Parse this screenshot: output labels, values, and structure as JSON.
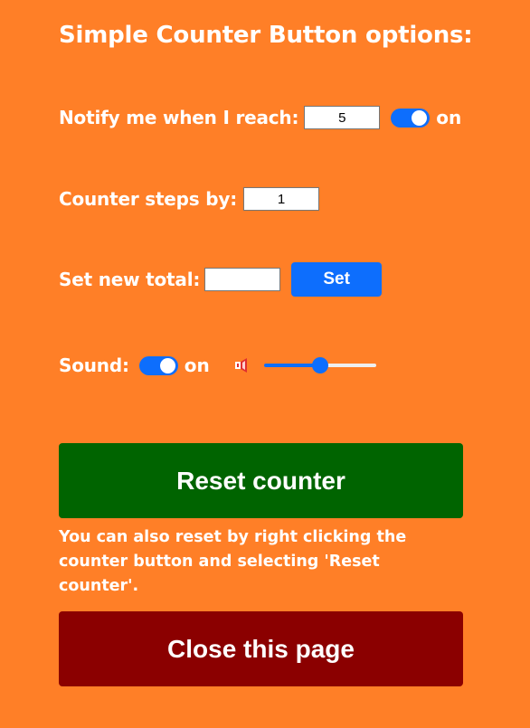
{
  "page": {
    "title": "Simple Counter Button options:"
  },
  "notify": {
    "label": "Notify me when I reach:",
    "value": "5",
    "toggle_on": true,
    "toggle_text": "on"
  },
  "steps": {
    "label": "Counter steps by:",
    "value": "1"
  },
  "total": {
    "label": "Set new total:",
    "value": "",
    "button_label": "Set"
  },
  "sound": {
    "label": "Sound:",
    "toggle_on": true,
    "toggle_text": "on",
    "speaker_icon": "speaker-icon",
    "volume_fraction": 0.5
  },
  "reset": {
    "button_label": "Reset counter",
    "help_text": "You can also reset by right clicking the counter button and selecting 'Reset counter'."
  },
  "close": {
    "button_label": "Close this page"
  },
  "colors": {
    "background": "#ff7f27",
    "accent": "#0d6efd",
    "reset_button": "#006400",
    "close_button": "#8b0000"
  }
}
